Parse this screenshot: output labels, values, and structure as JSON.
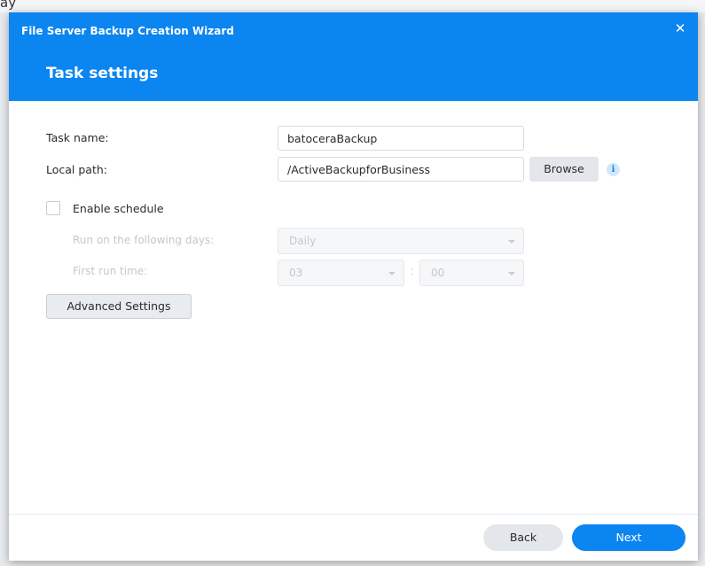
{
  "background": {
    "top_text": "ay"
  },
  "dialog": {
    "window_title": "File Server Backup Creation Wizard",
    "close_icon": "close-icon",
    "step_title": "Task settings",
    "accent_color": "#0b85f0"
  },
  "form": {
    "task_name_label": "Task name:",
    "task_name_value": "batoceraBackup",
    "local_path_label": "Local path:",
    "local_path_value": "/ActiveBackupforBusiness",
    "browse_label": "Browse",
    "info_icon": "info-icon",
    "enable_schedule_label": "Enable schedule",
    "enable_schedule_checked": false,
    "run_days_label": "Run on the following days:",
    "run_days_value": "Daily",
    "first_run_label": "First run time:",
    "first_run_hour": "03",
    "first_run_separator": ":",
    "first_run_minute": "00",
    "advanced_settings_label": "Advanced Settings"
  },
  "footer": {
    "back_label": "Back",
    "next_label": "Next"
  }
}
